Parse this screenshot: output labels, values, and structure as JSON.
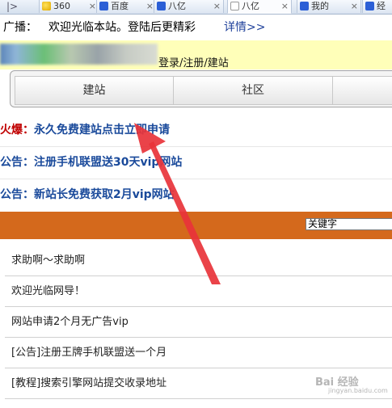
{
  "tabs": [
    {
      "icon": "360-icon",
      "label": "360",
      "close": "×"
    },
    {
      "icon": "paw-icon",
      "label": "百度",
      "close": "×"
    },
    {
      "icon": "paw-icon",
      "label": "八亿",
      "close": "×"
    },
    {
      "icon": "page-icon",
      "label": "八亿",
      "close": "×",
      "active": true
    },
    {
      "icon": "paw-icon",
      "label": "我的",
      "close": "×"
    },
    {
      "icon": "paw-icon",
      "label": "经",
      "close": ""
    }
  ],
  "tab_nav": "|>",
  "broadcast": {
    "label": "广播：",
    "text": "欢迎光临本站。登陆后更精彩",
    "link": "详情>>"
  },
  "header": {
    "links": "登录/注册/建站"
  },
  "nav": {
    "items": [
      "建站",
      "社区",
      ""
    ]
  },
  "announcements": [
    {
      "prefix": "火爆：",
      "text": "永久免费建站点击立即申请",
      "hot": true
    },
    {
      "prefix": "公告：",
      "text": "注册手机联盟送30天vip网站"
    },
    {
      "prefix": "公告：",
      "text": "新站长免费获取2月vip网站"
    }
  ],
  "search": {
    "value": "关键字"
  },
  "list": [
    "求助啊～求助啊",
    "欢迎光临网导！",
    "网站申请2个月无广告vip",
    "[公告]注册王牌手机联盟送一个月",
    "[教程]搜索引擎网站提交收录地址"
  ],
  "colors": {
    "accent_orange": "#d4691c",
    "header_yellow": "#ffffb9",
    "link_blue": "#1a4a9b",
    "arrow_red": "#e8333a"
  },
  "watermark": {
    "text": "Bai 经验",
    "sub": "jingyan.baidu.com"
  }
}
